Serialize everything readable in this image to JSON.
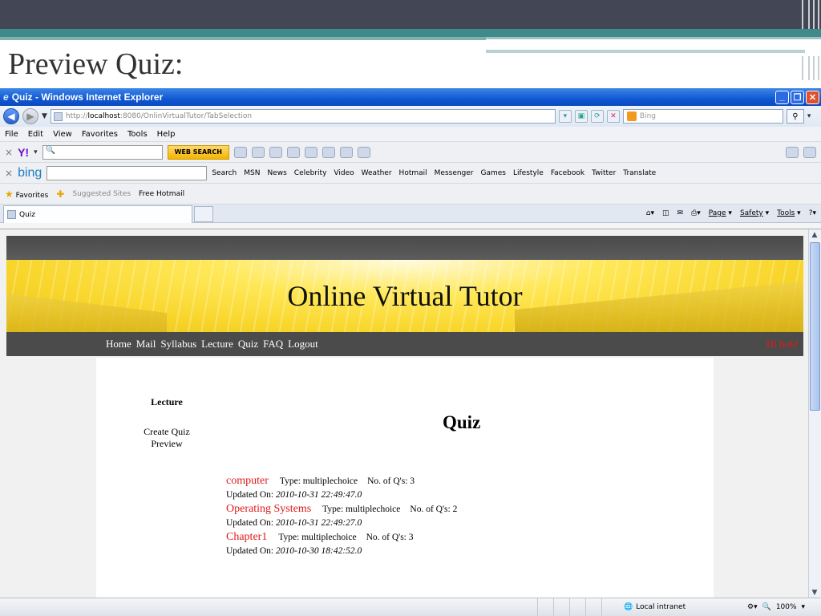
{
  "slide": {
    "title": "Preview Quiz:"
  },
  "window": {
    "title": "Quiz - Windows Internet Explorer",
    "url_prefix": "http://",
    "url_host": "localhost",
    "url_rest": ":8080/OnlinVirtualTutor/TabSelection",
    "search_placeholder": "Bing"
  },
  "menu": [
    "File",
    "Edit",
    "View",
    "Favorites",
    "Tools",
    "Help"
  ],
  "yahoo_toolbar": {
    "logo": "Y!",
    "search_button": "WEB SEARCH"
  },
  "bing_toolbar": {
    "logo": "bing",
    "items": [
      "Search",
      "MSN",
      "News",
      "Celebrity",
      "Video",
      "Weather",
      "Hotmail",
      "Messenger",
      "Games",
      "Lifestyle",
      "Facebook",
      "Twitter",
      "Translate"
    ]
  },
  "favorites_bar": {
    "favorites": "Favorites",
    "suggested": "Suggested Sites",
    "hotmail": "Free Hotmail"
  },
  "tab": {
    "label": "Quiz"
  },
  "command_bar": {
    "page": "Page",
    "safety": "Safety",
    "tools": "Tools"
  },
  "site": {
    "banner_title": "Online Virtual Tutor",
    "nav": [
      "Home",
      "Mail",
      "Syllabus",
      "Lecture",
      "Quiz",
      "FAQ",
      "Logout"
    ],
    "greeting": "Hi bob!",
    "sidebar": {
      "heading": "Lecture",
      "items": [
        "Create Quiz",
        "Preview"
      ]
    },
    "page_heading": "Quiz",
    "quizzes": [
      {
        "name": "computer",
        "type": "Type: multiplechoice",
        "count": "No. of Q's: 3",
        "updated_label": "Updated On:",
        "updated": "2010-10-31 22:49:47.0"
      },
      {
        "name": "Operating Systems",
        "type": "Type: multiplechoice",
        "count": "No. of Q's: 2",
        "updated_label": "Updated On:",
        "updated": "2010-10-31 22:49:27.0"
      },
      {
        "name": "Chapter1",
        "type": "Type: multiplechoice",
        "count": "No. of Q's: 3",
        "updated_label": "Updated On:",
        "updated": "2010-10-30 18:42:52.0"
      }
    ]
  },
  "status": {
    "zone": "Local intranet",
    "zoom": "100%"
  }
}
